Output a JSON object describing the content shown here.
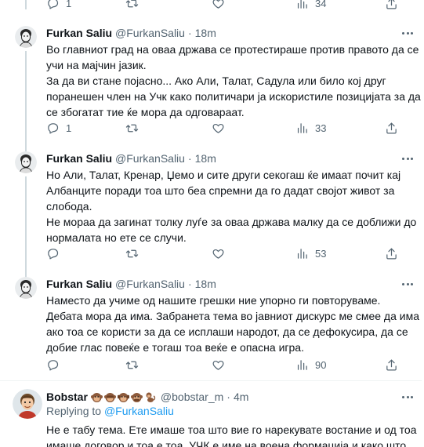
{
  "prev_actions": {
    "reply": "1",
    "retweet": "",
    "like": "",
    "views": "34"
  },
  "tweets": [
    {
      "name": "Furkan Saliu",
      "handle": "@FurkanSaliu",
      "separator": "·",
      "time": "18m",
      "lines": [
        "Во главниот град на оваа држава се протестираше против правото да се",
        "учи на мајчин јазик.",
        "За да ви стане појасно... Ако Али, Талат, Садула или било кој друг",
        "поранешен член на Учк како политичари ја искористиле позицијата за да",
        "се збогатат тие ќе мора да одговараат."
      ],
      "reply": "1",
      "retweet": "",
      "like": "",
      "views": "33"
    },
    {
      "name": "Furkan Saliu",
      "handle": "@FurkanSaliu",
      "separator": "·",
      "time": "18m",
      "lines": [
        "Но Али, Талат, Кренар, Џемо и сите други секогаш ќе имаат почит кај",
        "Албанците поради тоа што беа спремни да го дадат својот живот за",
        "слобода.",
        "Не мораа да загинат толку луѓе за оваа држава малку да се доближи до",
        "нормалата но ете се случи."
      ],
      "reply": "",
      "retweet": "",
      "like": "",
      "views": "53"
    },
    {
      "name": "Furkan Saliu",
      "handle": "@FurkanSaliu",
      "separator": "·",
      "time": "18m",
      "lines": [
        "Наместо да учиме од нашите грешки ние упорно ги повторуваме.",
        "Дебата мора да има. Забранета тема во јавниот дискурс ме смее да има но",
        "ако тоа се користи за да се исплаши народот, да се дефокусира, да се",
        "добие глас повеќе е тогаш тоа веќе е опасна игра."
      ],
      "reply": "",
      "retweet": "",
      "like": "",
      "views": "90"
    }
  ],
  "reply_tweet": {
    "name": "Bobstar",
    "handle": "@bobstar_m",
    "separator": "·",
    "time": "4m",
    "emojis": [
      "monkey-face",
      "see-no-evil-monkey",
      "hear-no-evil-monkey",
      "speak-no-evil-monkey",
      "monkey"
    ],
    "replying_prefix": "Replying to",
    "replying_handle": "@FurkanSaliu",
    "lines": [
      "Не е табу тема. Ете имаше тоа што вие го нарекувате востание и од тоа",
      "имаше договор и тоа е тоа. УЧК е име на воена формација и како што"
    ]
  },
  "colors": {
    "text": "#0f1419",
    "secondary": "#536471",
    "accent": "#1d9bf0",
    "divider": "#eff3f4",
    "thread": "#cfd9de"
  }
}
